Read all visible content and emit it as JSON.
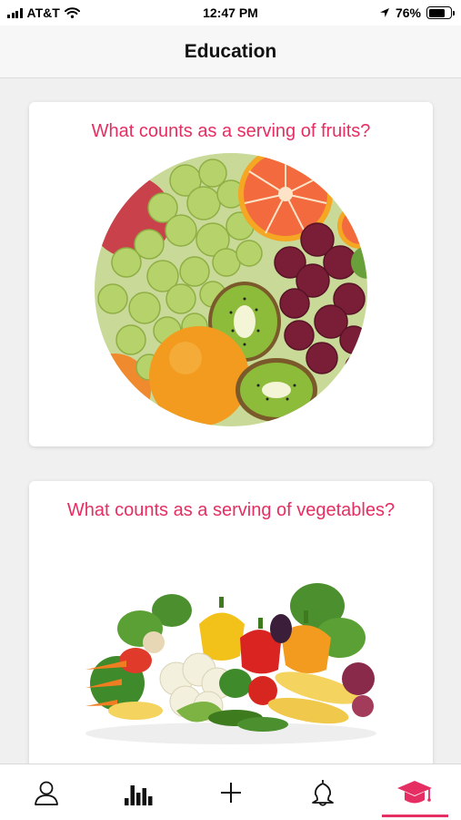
{
  "status_bar": {
    "carrier": "AT&T",
    "time": "12:47 PM",
    "battery": "76%",
    "battery_level": 0.76
  },
  "header": {
    "title": "Education"
  },
  "cards": [
    {
      "title": "What counts as a serving of fruits?"
    },
    {
      "title": "What counts as a serving of vegetables?"
    }
  ],
  "tab_bar": {
    "tabs": [
      {
        "icon": "profile-icon"
      },
      {
        "icon": "stats-icon"
      },
      {
        "icon": "add-icon"
      },
      {
        "icon": "bell-icon"
      },
      {
        "icon": "graduation-cap-icon",
        "active": true
      }
    ]
  },
  "colors": {
    "accent": "#e52e62",
    "background": "#f0f0f0"
  }
}
